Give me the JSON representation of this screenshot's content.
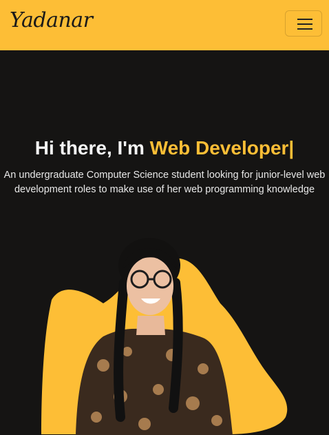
{
  "nav": {
    "brand": "Yadanar",
    "menu_icon": "hamburger-menu-icon",
    "bg_color": "#fdbe36"
  },
  "hero": {
    "greeting": "Hi there, I'm",
    "role": "Web Developer",
    "cursor": "|",
    "description": "An undergraduate Computer Science student looking for junior-level web development roles to make use of her web programming knowledge",
    "accent_color": "#fdbe36",
    "background_color": "#151413"
  }
}
